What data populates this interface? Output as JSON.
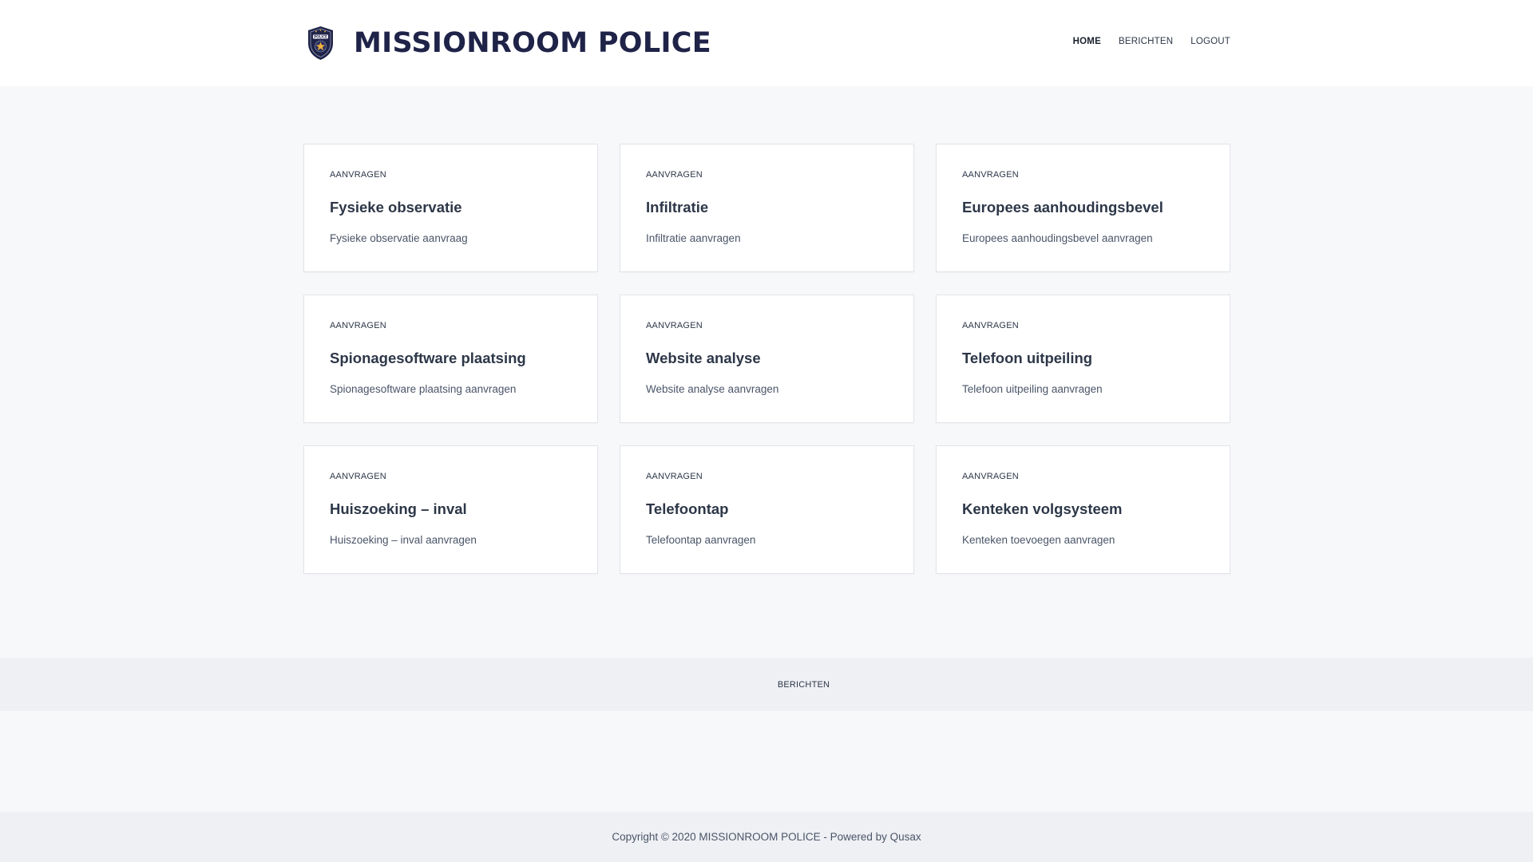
{
  "header": {
    "logo_icon": "police-badge-icon",
    "logo_text": "POLICE",
    "title": "MISSIONROOM POLICE",
    "nav": [
      {
        "label": "HOME",
        "active": true
      },
      {
        "label": "BERICHTEN",
        "active": false
      },
      {
        "label": "LOGOUT",
        "active": false
      }
    ]
  },
  "cards": [
    {
      "category": "AANVRAGEN",
      "title": "Fysieke observatie",
      "description": "Fysieke observatie aanvraag"
    },
    {
      "category": "AANVRAGEN",
      "title": "Infiltratie",
      "description": "Infiltratie aanvragen"
    },
    {
      "category": "AANVRAGEN",
      "title": "Europees aanhoudingsbevel",
      "description": "Europees aanhoudingsbevel aanvragen"
    },
    {
      "category": "AANVRAGEN",
      "title": "Spionagesoftware plaatsing",
      "description": "Spionagesoftware plaatsing aanvragen"
    },
    {
      "category": "AANVRAGEN",
      "title": "Website analyse",
      "description": "Website analyse aanvragen"
    },
    {
      "category": "AANVRAGEN",
      "title": "Telefoon uitpeiling",
      "description": "Telefoon uitpeiling aanvragen"
    },
    {
      "category": "AANVRAGEN",
      "title": "Huiszoeking – inval",
      "description": "Huiszoeking – inval aanvragen"
    },
    {
      "category": "AANVRAGEN",
      "title": "Telefoontap",
      "description": "Telefoontap aanvragen"
    },
    {
      "category": "AANVRAGEN",
      "title": "Kenteken volgsysteem",
      "description": "Kenteken toevoegen aanvragen"
    }
  ],
  "footer_nav": {
    "link_label": "BERICHTEN"
  },
  "footer": {
    "copyright": "Copyright © 2020 MISSIONROOM POLICE - Powered by Qusax"
  },
  "colors": {
    "brand": "#1f2348",
    "badge_star": "#f2b33d",
    "page_background": "#f7f8fa",
    "footer_background": "#eff0f4"
  }
}
